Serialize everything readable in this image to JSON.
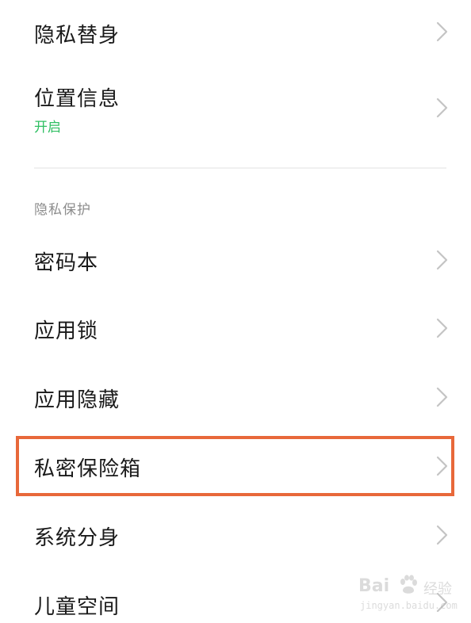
{
  "colors": {
    "title_text": "#1a1a1a",
    "status_green": "#2fbf62",
    "section_header": "#8c8c8c",
    "chevron": "#c4c4c4",
    "highlight_border": "#e8683a"
  },
  "top_items": [
    {
      "title": "隐私替身",
      "icon": "chevron-right-icon"
    },
    {
      "title": "位置信息",
      "subtitle": "开启",
      "icon": "chevron-right-icon"
    }
  ],
  "privacy_section": {
    "header": "隐私保护",
    "items": [
      {
        "title": "密码本",
        "icon": "chevron-right-icon"
      },
      {
        "title": "应用锁",
        "icon": "chevron-right-icon"
      },
      {
        "title": "应用隐藏",
        "icon": "chevron-right-icon"
      },
      {
        "title": "私密保险箱",
        "icon": "chevron-right-icon",
        "highlighted": true
      },
      {
        "title": "系统分身",
        "icon": "chevron-right-icon"
      },
      {
        "title": "儿童空间",
        "icon": "chevron-right-icon"
      }
    ]
  },
  "watermark": {
    "brand": "Bai",
    "brand_cn": "经验",
    "url": "jingyan.baidu.com"
  }
}
